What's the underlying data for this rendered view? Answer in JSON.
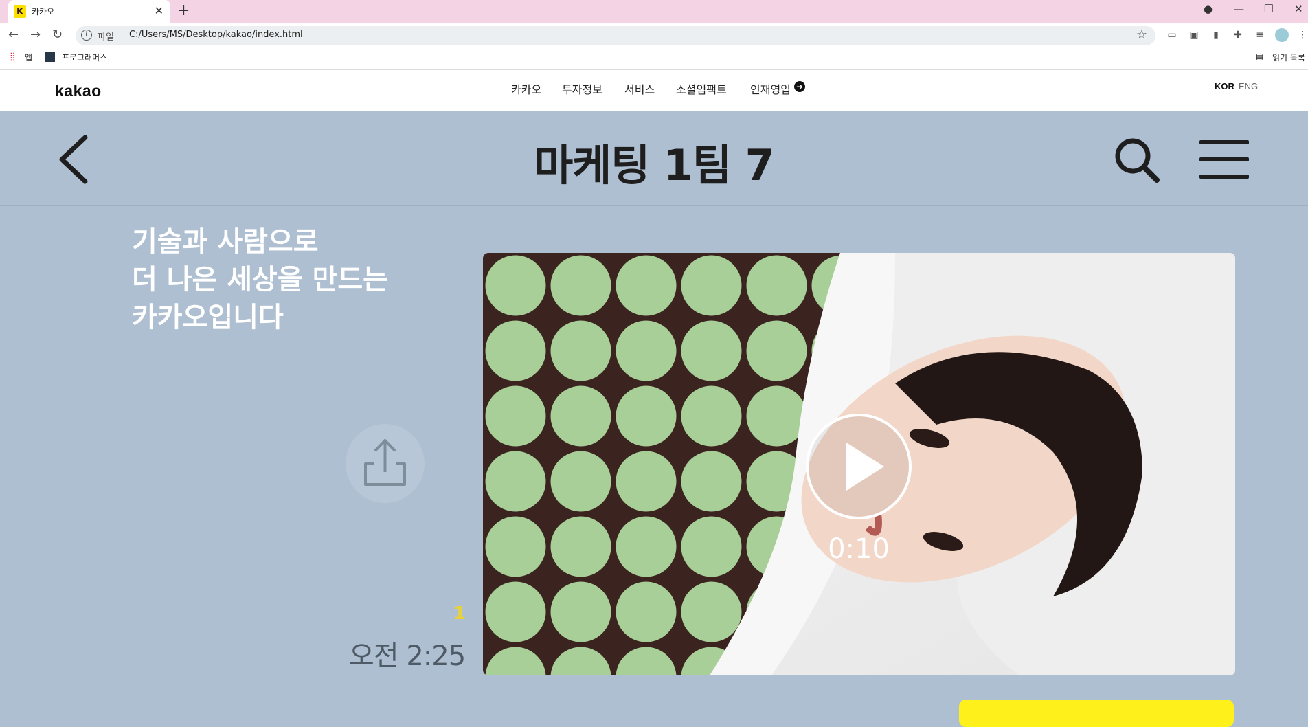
{
  "browser": {
    "tab_title": "카카오",
    "tab_favicon": "K",
    "url_scheme_label": "파일",
    "url": "C:/Users/MS/Desktop/kakao/index.html",
    "bookmarks": {
      "apps_label": "앱",
      "programmers_label": "프로그래머스",
      "reading_list_label": "읽기 목록"
    }
  },
  "site": {
    "logo": "kakao",
    "nav": [
      "카카오",
      "투자정보",
      "서비스",
      "소셜임팩트",
      "인재영입"
    ],
    "lang_kor": "KOR",
    "lang_eng": "ENG"
  },
  "chat": {
    "room_title": "마케팅 1팀 7",
    "headline": [
      "기술과 사람으로",
      "더 나은 세상을 만드는",
      "카카오입니다"
    ],
    "read_count": "1",
    "message_time": "오전 2:25",
    "video_duration": "0:10"
  },
  "colors": {
    "chat_bg": "#aebfd1",
    "kakao_yellow": "#fef01b",
    "tab_bar": "#f4d4e4"
  }
}
